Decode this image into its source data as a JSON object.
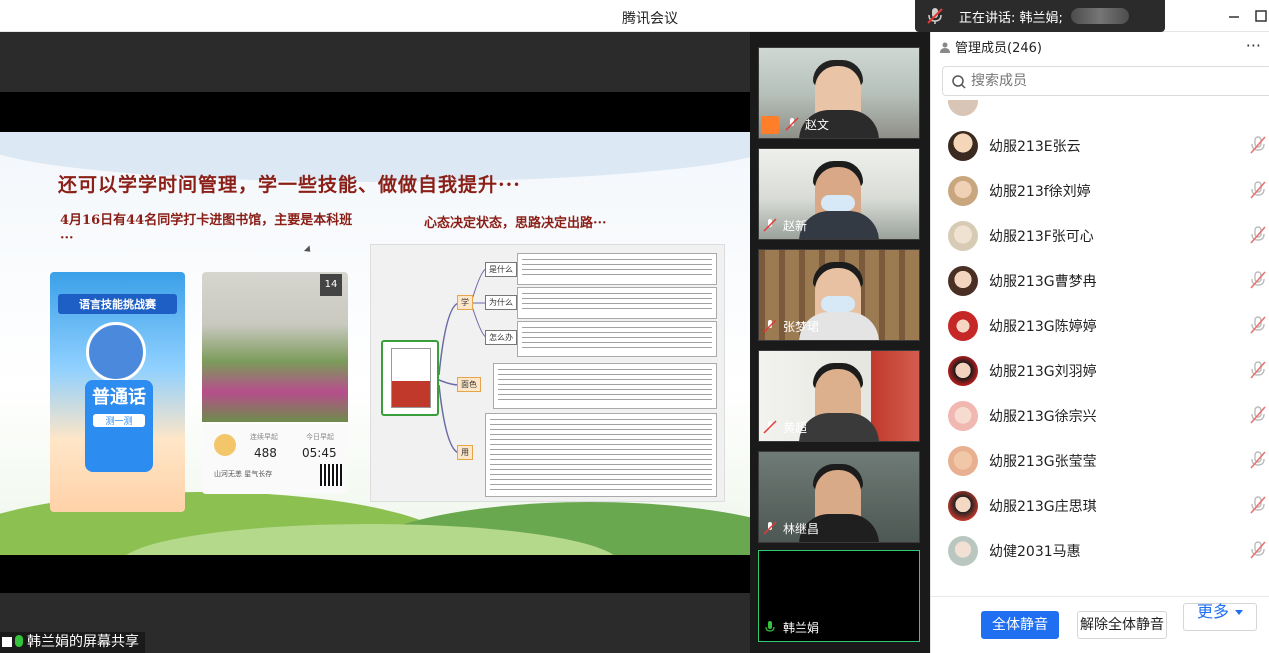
{
  "window": {
    "title": "腾讯会议",
    "speaking_label": "正在讲话: 韩兰娟;"
  },
  "share": {
    "label": "韩兰娟的屏幕共享",
    "slide": {
      "heading": "还可以学学时间管理，学一些技能、做做自我提升···",
      "left_text": "4月16日有44名同学打卡进图书馆，主要是本科班···",
      "right_text": "心态决定状态，思路决定出路···",
      "poster": {
        "title": "语言技能挑战赛",
        "big_text": "普通话",
        "button": "测一测"
      },
      "phone": {
        "date": "14",
        "stat1_label": "连续早起",
        "stat1_value": "488",
        "stat2_label": "今日早起",
        "stat2_value": "05:45",
        "location": "山河无恙 星气长存"
      },
      "mindmap": {
        "nodes": [
          "学",
          "面色",
          "用",
          "是什么",
          "为什么",
          "怎么办"
        ]
      }
    }
  },
  "videos": [
    {
      "name": "赵文",
      "host": true
    },
    {
      "name": "赵新",
      "host": false
    },
    {
      "name": "张梦珺",
      "host": false
    },
    {
      "name": "黄超",
      "host": false
    },
    {
      "name": "林继昌",
      "host": false
    },
    {
      "name": "韩兰娟",
      "host": false,
      "active": true
    }
  ],
  "panel": {
    "title": "管理成员(246)",
    "more": "···",
    "search_placeholder": "搜索成员",
    "members": [
      {
        "name": "幼服213E张云"
      },
      {
        "name": "幼服213f徐刘婷"
      },
      {
        "name": "幼服213F张可心"
      },
      {
        "name": "幼服213G曹梦冉"
      },
      {
        "name": "幼服213G陈婷婷"
      },
      {
        "name": "幼服213G刘羽婷"
      },
      {
        "name": "幼服213G徐宗兴"
      },
      {
        "name": "幼服213G张莹莹"
      },
      {
        "name": "幼服213G庄思琪"
      },
      {
        "name": "幼健2031马惠"
      }
    ],
    "buttons": {
      "mute_all": "全体静音",
      "unmute_all": "解除全体静音",
      "more": "更多"
    }
  },
  "colors": {
    "accent": "#1f6ff0",
    "active_border": "#2ecc71",
    "mic_off": "#e53935"
  }
}
